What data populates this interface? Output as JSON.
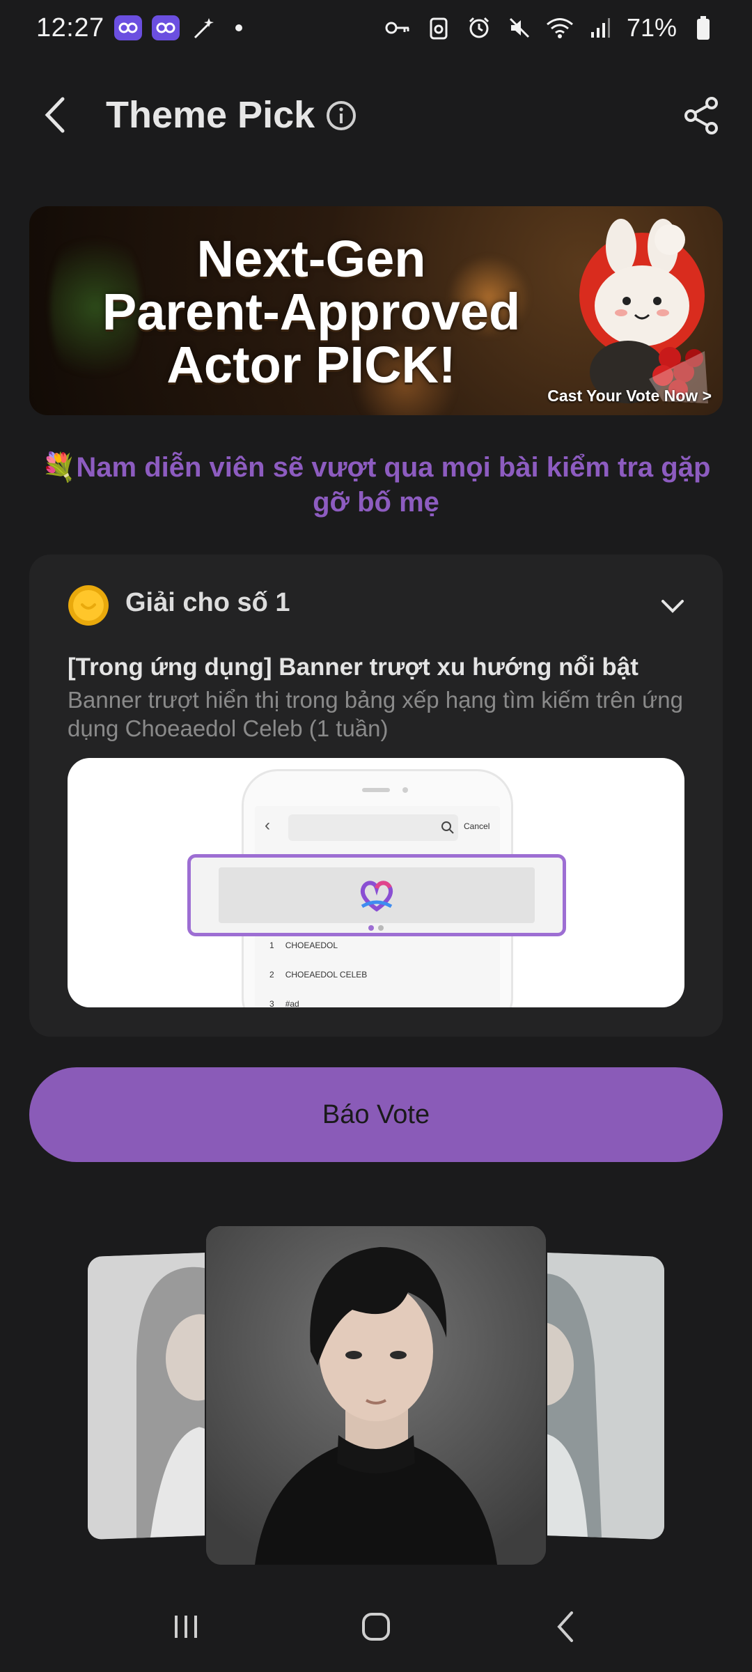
{
  "status": {
    "time": "12:27",
    "battery": "71%"
  },
  "header": {
    "title": "Theme Pick"
  },
  "banner": {
    "title_line1": "Next-Gen",
    "title_line2": "Parent-Approved",
    "title_line3": "Actor PICK!",
    "cta": "Cast Your Vote Now >"
  },
  "theme": {
    "emoji": "💐",
    "title": "Nam diễn viên sẽ vượt qua mọi bài kiểm tra gặp gỡ bố mẹ"
  },
  "prize": {
    "label": "Giải cho số 1",
    "name": "[Trong ứng dụng] Banner trượt xu hướng nổi bật",
    "description": "Banner trượt hiển thị trong bảng xếp hạng tìm kiếm trên ứng dụng Choeaedol Celeb (1 tuần)",
    "preview": {
      "cancel": "Cancel",
      "ranks": [
        {
          "num": "1",
          "text": "CHOEAEDOL"
        },
        {
          "num": "2",
          "text": "CHOEAEDOL CELEB"
        },
        {
          "num": "3",
          "text": "#ad"
        }
      ]
    }
  },
  "vote_button": {
    "label": "Báo Vote"
  },
  "colors": {
    "accent": "#8a5bb8",
    "subtitle": "#8d5cc0",
    "background": "#1b1b1c",
    "card": "#232324"
  },
  "icons": {
    "back": "chevron-left-icon",
    "info": "info-icon",
    "share": "share-icon",
    "coin": "coin-icon",
    "expand": "chevron-down-icon"
  }
}
